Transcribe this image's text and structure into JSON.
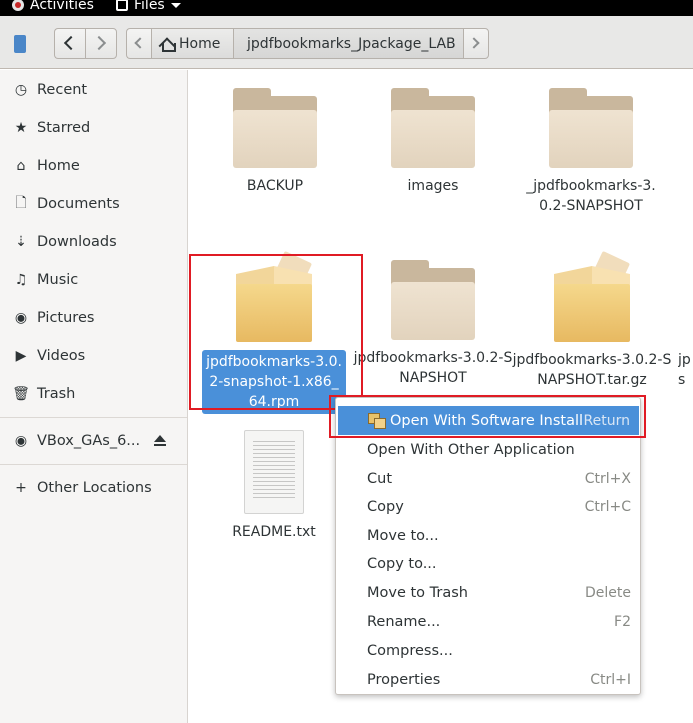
{
  "topbar": {
    "activities": "Activities",
    "app_menu": "Files"
  },
  "header": {
    "path_home": "Home",
    "path_current": "jpdfbookmarks_Jpackage_LAB"
  },
  "sidebar": {
    "items": [
      {
        "label": "Recent",
        "icon": "clock-icon"
      },
      {
        "label": "Starred",
        "icon": "star-icon"
      },
      {
        "label": "Home",
        "icon": "home-icon"
      },
      {
        "label": "Documents",
        "icon": "document-icon"
      },
      {
        "label": "Downloads",
        "icon": "download-icon"
      },
      {
        "label": "Music",
        "icon": "music-icon"
      },
      {
        "label": "Pictures",
        "icon": "camera-icon"
      },
      {
        "label": "Videos",
        "icon": "video-icon"
      },
      {
        "label": "Trash",
        "icon": "trash-icon"
      }
    ],
    "device": {
      "label": "VBox_GAs_6...",
      "icon": "disc-icon"
    },
    "other": {
      "label": "Other Locations",
      "icon": "plus-icon"
    }
  },
  "files": [
    {
      "name": "BACKUP",
      "kind": "folder"
    },
    {
      "name": "images",
      "kind": "folder"
    },
    {
      "name": "_jpdfbookmarks-3.0.2-SNAPSHOT",
      "kind": "folder"
    },
    {
      "name": "jpdfbookmarks-3.0.2-snapshot-1.x86_64.rpm",
      "kind": "package",
      "selected": true
    },
    {
      "name": "jpdfbookmarks-3.0.2-SNAPSHOT",
      "kind": "folder"
    },
    {
      "name": "jpdfbookmarks-3.0.2-SNAPSHOT.tar.gz",
      "kind": "package"
    },
    {
      "name": "README.txt",
      "kind": "text"
    }
  ],
  "partial_file_label": "jp\ns",
  "context_menu": [
    {
      "label": "Open With Software Install",
      "accel": "Return",
      "highlighted": true
    },
    {
      "label": "Open With Other Application",
      "accel": ""
    },
    {
      "label": "Cut",
      "accel": "Ctrl+X"
    },
    {
      "label": "Copy",
      "accel": "Ctrl+C"
    },
    {
      "label": "Move to...",
      "accel": ""
    },
    {
      "label": "Copy to...",
      "accel": ""
    },
    {
      "label": "Move to Trash",
      "accel": "Delete"
    },
    {
      "label": "Rename...",
      "accel": "F2"
    },
    {
      "label": "Compress...",
      "accel": ""
    },
    {
      "label": "Properties",
      "accel": "Ctrl+I"
    }
  ],
  "colors": {
    "selection": "#4a90d9",
    "highlight_box": "#e01b24"
  }
}
